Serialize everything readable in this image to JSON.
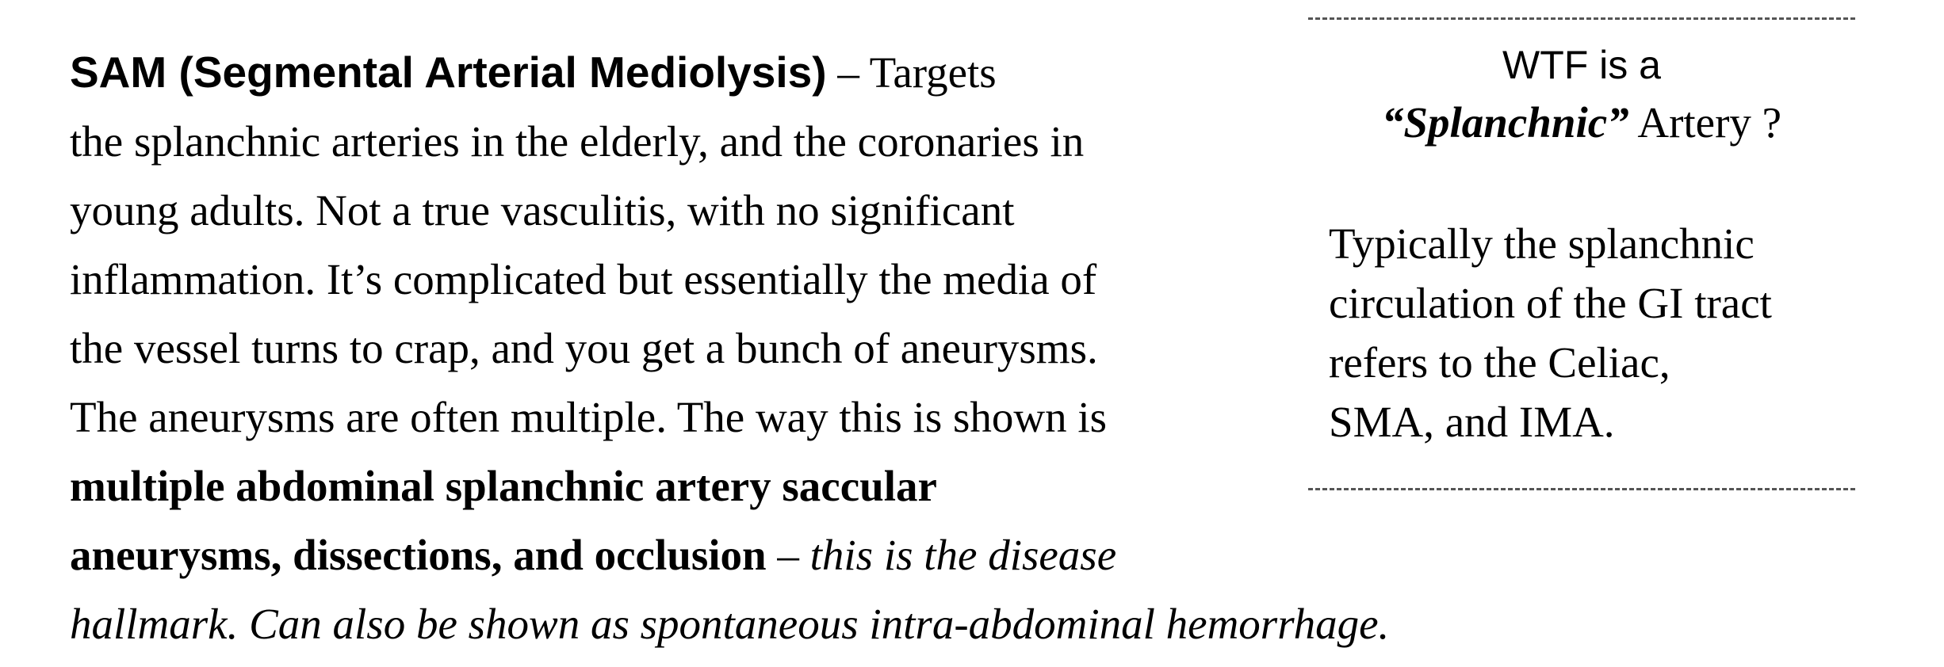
{
  "main": {
    "heading": "SAM (Segmental Arterial Mediolysis)",
    "line1_rest": " – Targets",
    "line2": "the splanchnic arteries in the elderly, and the coronaries in",
    "line3": "young adults.  Not a true vasculitis, with no significant",
    "line4": "inflammation.  It’s complicated but essentially the media of",
    "line5": "the vessel turns to crap, and you get a bunch of aneurysms.",
    "line6": "The aneurysms are often multiple.  The way this is shown is",
    "line7_bold": "multiple abdominal splanchnic artery saccular",
    "line8_bold": "aneurysms, dissections, and occlusion",
    "line8_dash": " – ",
    "line8_italic": "this is the disease",
    "line9_italic": "hallmark.  Can also be shown as spontaneous intra-abdominal hemorrhage."
  },
  "sidebar": {
    "title_line1": "WTF is a",
    "title_term": "“Splanchnic”",
    "title_rest": " Artery ?",
    "body_lines": [
      "Typically the splanchnic",
      "circulation of the GI tract",
      "refers to the Celiac,",
      "SMA, and IMA."
    ]
  }
}
